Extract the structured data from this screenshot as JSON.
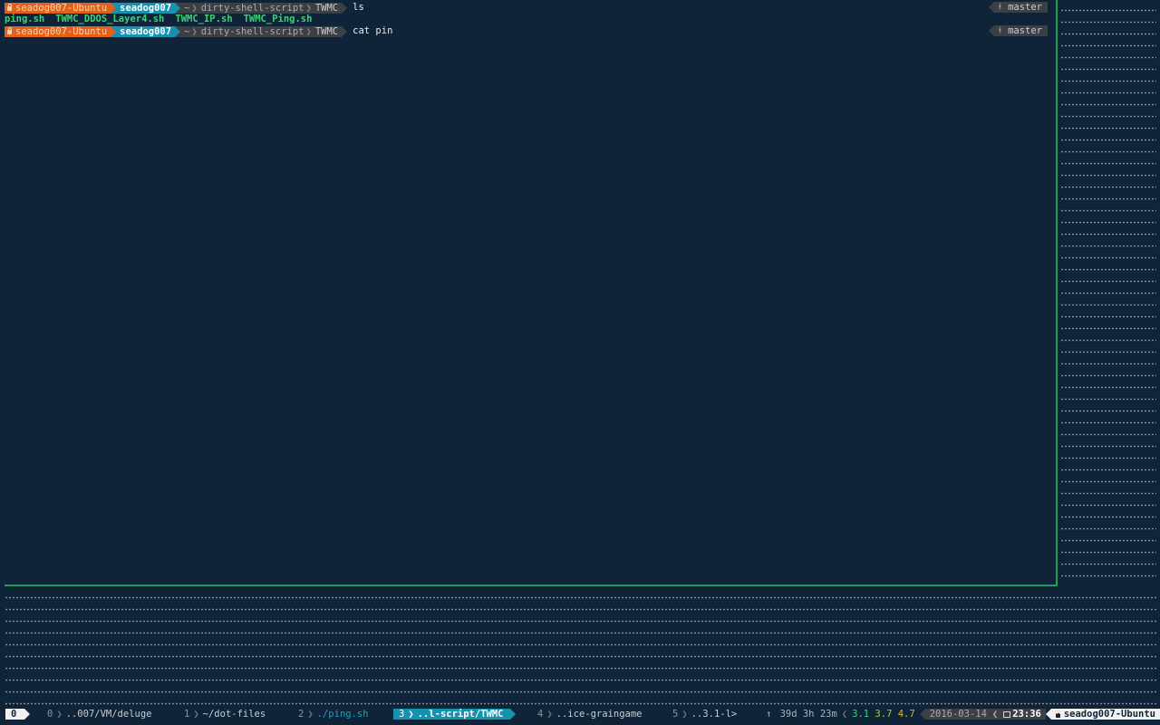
{
  "prompt": {
    "host": "seadog007-Ubuntu",
    "user": "seadog007",
    "path": [
      "~",
      "dirty-shell-script",
      "TWMC"
    ],
    "branch": "master"
  },
  "commands": [
    "ls",
    "cat pin"
  ],
  "ls_output": [
    "ping.sh",
    "TWMC_DDOS_Layer4.sh",
    "TWMC_IP.sh",
    "TWMC_Ping.sh"
  ],
  "tmux": {
    "session": "0",
    "windows": [
      {
        "index": "0",
        "name": "..007/VM/deluge"
      },
      {
        "index": "1",
        "name": "~/dot-files"
      },
      {
        "index": "2",
        "name": "./ping.sh"
      },
      {
        "index": "3",
        "name": "..l-script/TWMC",
        "current": true
      },
      {
        "index": "4",
        "name": "..ice-graingame"
      },
      {
        "index": "5",
        "name": "..3.1-l>"
      }
    ],
    "uptime_arrow": "↑",
    "uptime": "39d 3h 23m",
    "load": [
      "3.1",
      "3.7",
      "4.7"
    ],
    "date": "2016-03-14",
    "time": "23:36",
    "hostname": "seadog007-Ubuntu"
  },
  "colors": {
    "background": "#0f2439",
    "host_segment": "#e0601c",
    "user_segment": "#1592b0",
    "path_segment": "#3c3f44",
    "pane_border": "#1f9f54",
    "ls_files": "#3ed27a"
  }
}
